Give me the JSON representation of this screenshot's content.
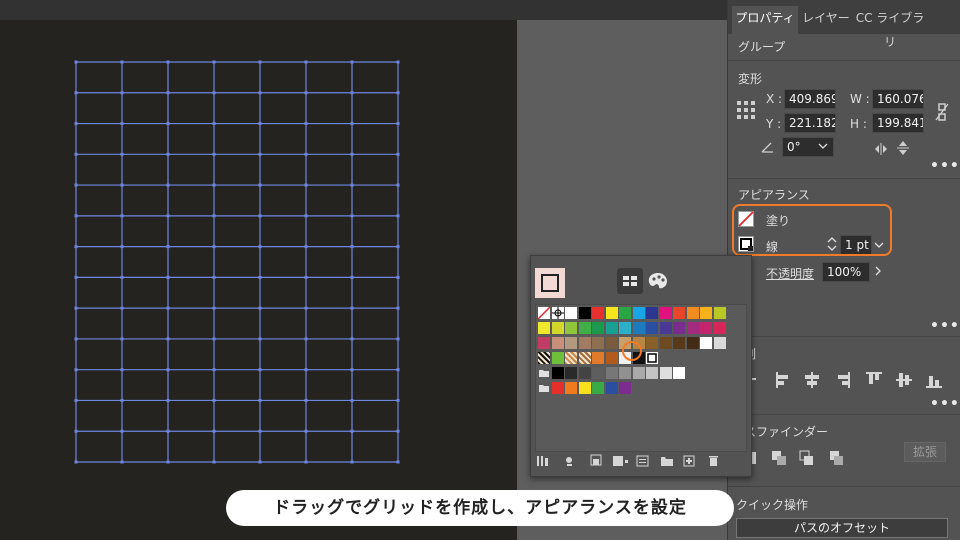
{
  "panel": {
    "tabs": [
      "プロパティ",
      "レイヤー",
      "CC ライブラリ"
    ],
    "group_label": "グループ",
    "transform": {
      "title": "変形",
      "x_label": "X :",
      "x_value": "409.869",
      "y_label": "Y :",
      "y_value": "221.182",
      "w_label": "W :",
      "w_value": "160.076",
      "h_label": "H :",
      "h_value": "199.841",
      "angle_value": "0°"
    },
    "appearance": {
      "title": "アピアランス",
      "fill_label": "塗り",
      "stroke_label": "線",
      "stroke_weight": "1 pt",
      "opacity_label": "不透明度",
      "opacity_value": "100%"
    },
    "align_title": "整列",
    "align_title_visible": "列",
    "pathfinder_title_visible": "スファインダー",
    "expand_button": "拡張",
    "quick_actions_title": "クイック操作",
    "offset_path_button": "パスのオフセット"
  },
  "caption": "ドラッグでグリッドを作成し、アピアランスを設定",
  "colors": {
    "grid_line": "#6f86e0",
    "highlight": "#ee7a2a",
    "panel_bg": "#535353"
  },
  "grid": {
    "columns": 7,
    "rows": 13
  },
  "swatches": {
    "row1": [
      "none",
      "reg",
      "#ffffff",
      "#000000",
      "#e8312f",
      "#f7e51d",
      "#2aa744",
      "#1aa6e4",
      "#2c3691",
      "#e2137f",
      "#e8462b",
      "#f18c21",
      "#f7b21a",
      "#b8c825"
    ],
    "row2": [
      "#f0e62c",
      "#d2d92a",
      "#8fc43b",
      "#3fae49",
      "#1a9a4a",
      "#19a094",
      "#2bb0c9",
      "#1d7bbf",
      "#2b4ea1",
      "#4a3a94",
      "#7b2d8f",
      "#a12b7e",
      "#c4256c",
      "#d8265a"
    ],
    "row3": [
      "#c13c64",
      "#c88f7a",
      "#b39a7f",
      "#a17c63",
      "#8e6f50",
      "#7a5b3d",
      "#c8a06a",
      "#b78642",
      "#8a6029",
      "#6d4a22",
      "#58391a",
      "#432b15",
      "#ffffff",
      "#d9d9d9"
    ],
    "row4": [
      "pattern1",
      "#6fbf3a",
      "pattern2",
      "pattern3",
      "#e07b2c",
      "#b35a1d",
      "#f0f0f0",
      "#111111",
      "selected"
    ],
    "row5": [
      "folder",
      "#000000",
      "#2a2a2a",
      "#444444",
      "#5e5e5e",
      "#777777",
      "#919191",
      "#aaaaaa",
      "#c4c4c4",
      "#dedede",
      "#ffffff"
    ],
    "row6": [
      "folder",
      "#e52f2a",
      "#f07a1e",
      "#f7e11c",
      "#3aaa47",
      "#2b4ea1",
      "#7b2d8f"
    ]
  }
}
